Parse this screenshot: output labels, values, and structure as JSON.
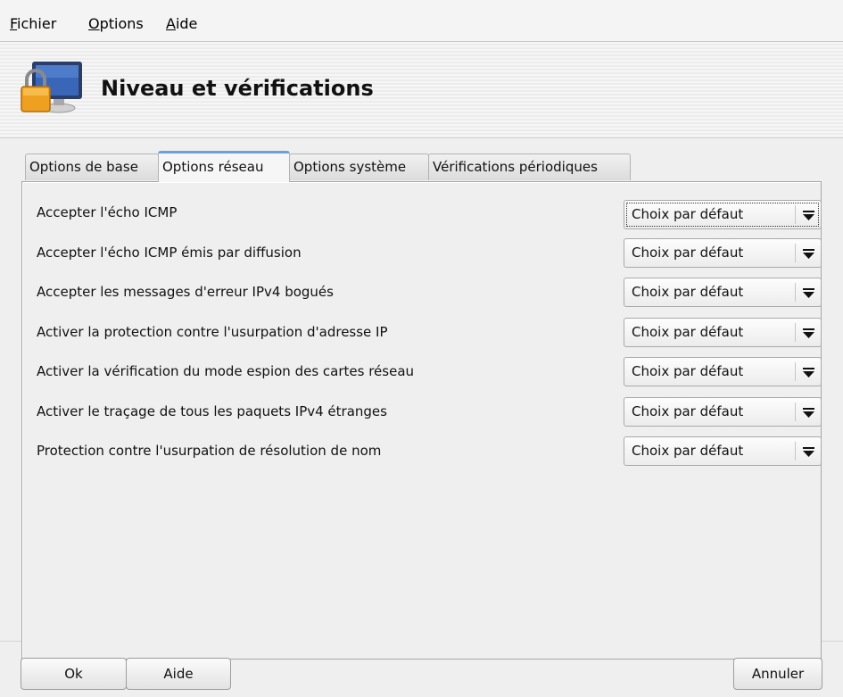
{
  "menubar": {
    "items": [
      {
        "accel": "F",
        "rest": "ichier"
      },
      {
        "accel": "O",
        "rest": "ptions"
      },
      {
        "accel": "A",
        "rest": "ide"
      }
    ]
  },
  "header": {
    "title": "Niveau et vérifications",
    "icon": "security-monitor-lock-icon"
  },
  "tabs": [
    {
      "label": "Options de base",
      "active": false
    },
    {
      "label": "Options réseau",
      "active": true
    },
    {
      "label": "Options système",
      "active": false
    },
    {
      "label": "Vérifications périodiques",
      "active": false
    }
  ],
  "options": [
    {
      "label": "Accepter l'écho ICMP",
      "value": "Choix par défaut"
    },
    {
      "label": "Accepter l'écho ICMP émis par diffusion",
      "value": "Choix par défaut"
    },
    {
      "label": "Accepter les messages d'erreur IPv4 bogués",
      "value": "Choix par défaut"
    },
    {
      "label": "Activer la protection contre l'usurpation d'adresse IP",
      "value": "Choix par défaut"
    },
    {
      "label": "Activer la vérification du mode espion des cartes réseau",
      "value": "Choix par défaut"
    },
    {
      "label": "Activer le traçage de tous les paquets IPv4 étranges",
      "value": "Choix par défaut"
    },
    {
      "label": "Protection contre l'usurpation de résolution de nom",
      "value": "Choix par défaut"
    }
  ],
  "buttons": {
    "ok": "Ok",
    "help": "Aide",
    "cancel": "Annuler"
  },
  "colors": {
    "active_tab_accent": "#6aa2d8",
    "window_bg": "#efefef"
  }
}
